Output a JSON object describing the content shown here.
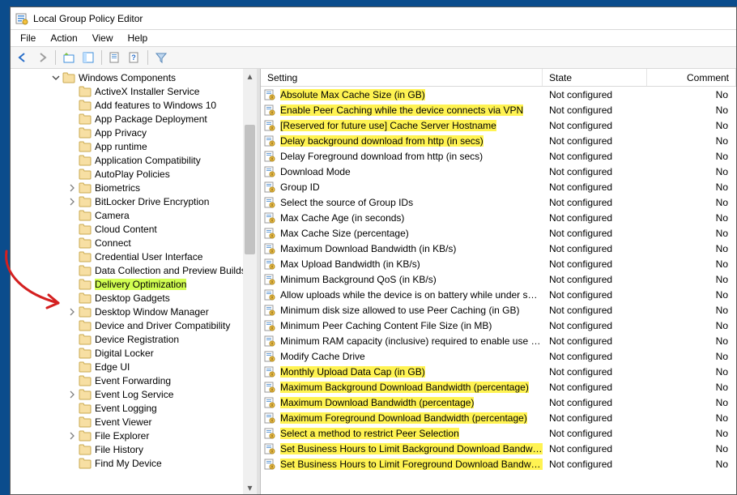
{
  "titlebar": {
    "title": "Local Group Policy Editor"
  },
  "menubar": [
    "File",
    "Action",
    "View",
    "Help"
  ],
  "tree": {
    "root_label": "Windows Components",
    "root_expanded": true,
    "items": [
      {
        "label": "ActiveX Installer Service"
      },
      {
        "label": "Add features to Windows 10"
      },
      {
        "label": "App Package Deployment"
      },
      {
        "label": "App Privacy"
      },
      {
        "label": "App runtime"
      },
      {
        "label": "Application Compatibility"
      },
      {
        "label": "AutoPlay Policies"
      },
      {
        "label": "Biometrics",
        "exp": "closed"
      },
      {
        "label": "BitLocker Drive Encryption",
        "exp": "closed"
      },
      {
        "label": "Camera"
      },
      {
        "label": "Cloud Content"
      },
      {
        "label": "Connect"
      },
      {
        "label": "Credential User Interface"
      },
      {
        "label": "Data Collection and Preview Builds"
      },
      {
        "label": "Delivery Optimization",
        "selected": true
      },
      {
        "label": "Desktop Gadgets"
      },
      {
        "label": "Desktop Window Manager",
        "exp": "closed"
      },
      {
        "label": "Device and Driver Compatibility"
      },
      {
        "label": "Device Registration"
      },
      {
        "label": "Digital Locker"
      },
      {
        "label": "Edge UI"
      },
      {
        "label": "Event Forwarding"
      },
      {
        "label": "Event Log Service",
        "exp": "closed"
      },
      {
        "label": "Event Logging"
      },
      {
        "label": "Event Viewer"
      },
      {
        "label": "File Explorer",
        "exp": "closed"
      },
      {
        "label": "File History"
      },
      {
        "label": "Find My Device"
      }
    ]
  },
  "list": {
    "columns": {
      "setting": "Setting",
      "state": "State",
      "comment": "Comment"
    },
    "default_state": "Not configured",
    "default_comment": "No",
    "rows": [
      {
        "name": "Absolute Max Cache Size (in GB)",
        "hl": true
      },
      {
        "name": "Enable Peer Caching while the device connects via VPN",
        "hl": true
      },
      {
        "name": "[Reserved for future use] Cache Server Hostname",
        "hl": true
      },
      {
        "name": "Delay background download from http (in secs)",
        "hl": true
      },
      {
        "name": "Delay Foreground download from http (in secs)"
      },
      {
        "name": "Download Mode"
      },
      {
        "name": "Group ID"
      },
      {
        "name": "Select the source of Group IDs"
      },
      {
        "name": "Max Cache Age (in seconds)"
      },
      {
        "name": "Max Cache Size (percentage)"
      },
      {
        "name": "Maximum Download Bandwidth (in KB/s)"
      },
      {
        "name": "Max Upload Bandwidth (in KB/s)"
      },
      {
        "name": "Minimum Background QoS (in KB/s)"
      },
      {
        "name": "Allow uploads while the device is on battery while under set ..."
      },
      {
        "name": "Minimum disk size allowed to use Peer Caching (in GB)"
      },
      {
        "name": "Minimum Peer Caching Content File Size (in MB)"
      },
      {
        "name": "Minimum RAM capacity (inclusive) required to enable use o..."
      },
      {
        "name": "Modify Cache Drive"
      },
      {
        "name": "Monthly Upload Data Cap (in GB)",
        "hl": true
      },
      {
        "name": "Maximum Background Download Bandwidth (percentage)",
        "hl": true
      },
      {
        "name": "Maximum Download Bandwidth (percentage)",
        "hl": true
      },
      {
        "name": "Maximum Foreground Download Bandwidth (percentage)",
        "hl": true
      },
      {
        "name": "Select a method to restrict Peer Selection",
        "hl": true
      },
      {
        "name": "Set Business Hours to Limit Background Download Bandwid...",
        "hl": true
      },
      {
        "name": "Set Business Hours to Limit Foreground Download Bandwidth",
        "hl": true
      }
    ]
  }
}
